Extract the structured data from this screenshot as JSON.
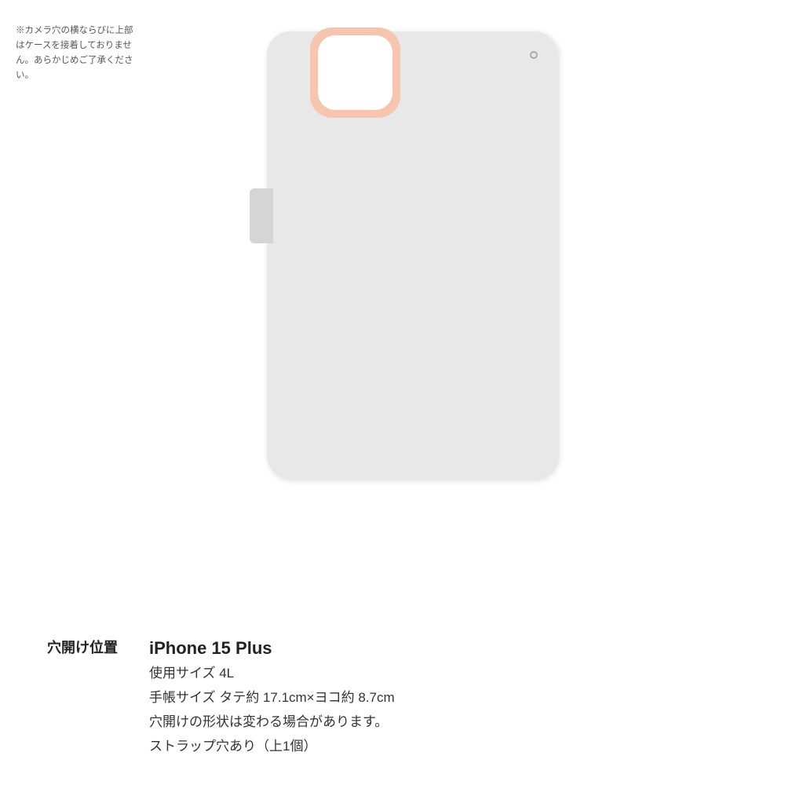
{
  "note": {
    "text": "※カメラ穴の横ならびに上部はケースを接着しておりません。あらかじめご了承ください。"
  },
  "info": {
    "label": "穴開け位置",
    "device_name": "iPhone 15 Plus",
    "size_label": "使用サイズ 4L",
    "dimensions_label": "手帳サイズ タテ約 17.1cm×ヨコ約 8.7cm",
    "shape_note": "穴開けの形状は変わる場合があります。",
    "strap_note": "ストラップ穴あり（上1個）"
  },
  "colors": {
    "case_bg": "#e8e8e8",
    "camera_corner": "#f5c5b0",
    "strap": "#d5d5d5",
    "text_main": "#222222",
    "text_secondary": "#555555"
  }
}
